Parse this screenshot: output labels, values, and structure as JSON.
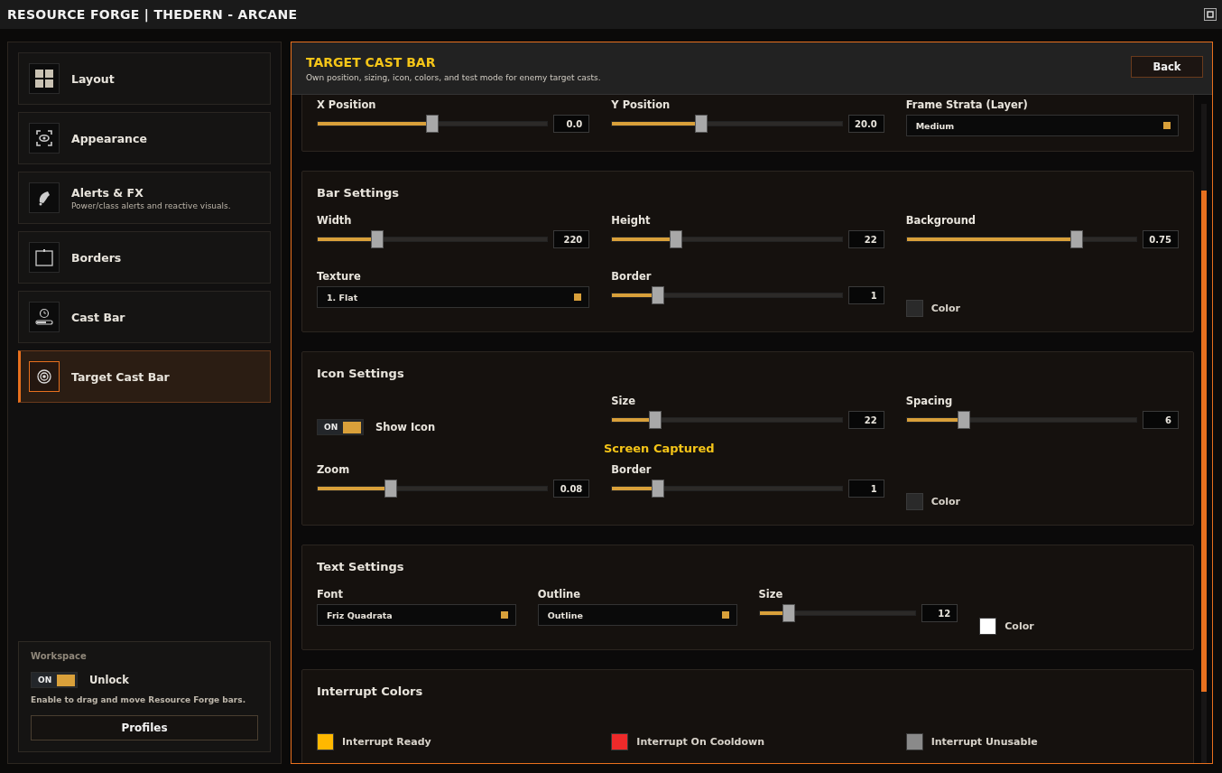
{
  "window": {
    "title": "RESOURCE FORGE | THEDERN - ARCANE"
  },
  "sidebar": {
    "items": [
      {
        "label": "Layout",
        "selected": false
      },
      {
        "label": "Appearance",
        "selected": false
      },
      {
        "label": "Alerts & FX",
        "subtitle": "Power/class alerts and reactive visuals.",
        "selected": false
      },
      {
        "label": "Borders",
        "selected": false
      },
      {
        "label": "Cast Bar",
        "selected": false
      },
      {
        "label": "Target Cast Bar",
        "selected": true
      }
    ],
    "workspace": {
      "title": "Workspace",
      "toggle": {
        "state_text": "ON",
        "on": true,
        "label": "Unlock"
      },
      "hint": "Enable to drag and move Resource Forge bars.",
      "button": "Profiles"
    }
  },
  "main": {
    "title": "TARGET CAST BAR",
    "subtitle": "Own position, sizing, icon, colors, and test mode for enemy target casts.",
    "back_button": "Back",
    "sections": [
      {
        "rows": [
          [
            {
              "kind": "slider",
              "label": "X Position",
              "level": 0.5,
              "value": "0.0"
            },
            {
              "kind": "slider",
              "label": "Y Position",
              "level": 0.39,
              "value": "20.0"
            },
            {
              "kind": "dropdown",
              "label": "Frame Strata (Layer)",
              "value": "Medium"
            }
          ]
        ]
      },
      {
        "title": "Bar Settings",
        "rows": [
          [
            {
              "kind": "slider",
              "label": "Width",
              "level": 0.26,
              "value": "220"
            },
            {
              "kind": "slider",
              "label": "Height",
              "level": 0.28,
              "value": "22"
            },
            {
              "kind": "slider",
              "label": "Background",
              "level": 0.74,
              "value": "0.75"
            }
          ],
          [
            {
              "kind": "dropdown",
              "label": "Texture",
              "value": "1. Flat"
            },
            {
              "kind": "slider",
              "label": "Border",
              "level": 0.2,
              "value": "1"
            },
            {
              "kind": "color",
              "label": "Color",
              "color": "#2a2a2a"
            }
          ]
        ]
      },
      {
        "title": "Icon Settings",
        "rows": [
          [
            {
              "kind": "toggle",
              "state_text": "ON",
              "on": true,
              "label": "Show Icon"
            },
            {
              "kind": "slider",
              "label": "Size",
              "level": 0.19,
              "value": "22"
            },
            {
              "kind": "slider",
              "label": "Spacing",
              "level": 0.25,
              "value": "6"
            }
          ],
          [
            {
              "kind": "slider",
              "label": "Zoom",
              "level": 0.32,
              "value": "0.08"
            },
            {
              "kind": "slider",
              "label": "Border",
              "level": 0.2,
              "value": "1"
            },
            {
              "kind": "color",
              "label": "Color",
              "color": "#2a2a2a"
            }
          ]
        ]
      },
      {
        "title": "Text Settings",
        "rows": [
          [
            {
              "kind": "dropdown",
              "label": "Font",
              "value": "Friz Quadrata"
            },
            {
              "kind": "dropdown",
              "label": "Outline",
              "value": "Outline"
            },
            {
              "kind": "slider",
              "label": "Size",
              "level": 0.19,
              "value": "12"
            },
            {
              "kind": "color",
              "label": "Color",
              "color": "#ffffff"
            }
          ]
        ]
      },
      {
        "title": "Interrupt Colors",
        "rows": [
          [
            {
              "kind": "color",
              "label": "Interrupt Ready",
              "color": "#ffb800"
            },
            {
              "kind": "color",
              "label": "Interrupt On Cooldown",
              "color": "#ee2a2a"
            },
            {
              "kind": "color",
              "label": "Interrupt Unusable",
              "color": "#8a8a8a"
            }
          ]
        ]
      }
    ]
  },
  "overlay": {
    "text": "Screen Captured"
  }
}
